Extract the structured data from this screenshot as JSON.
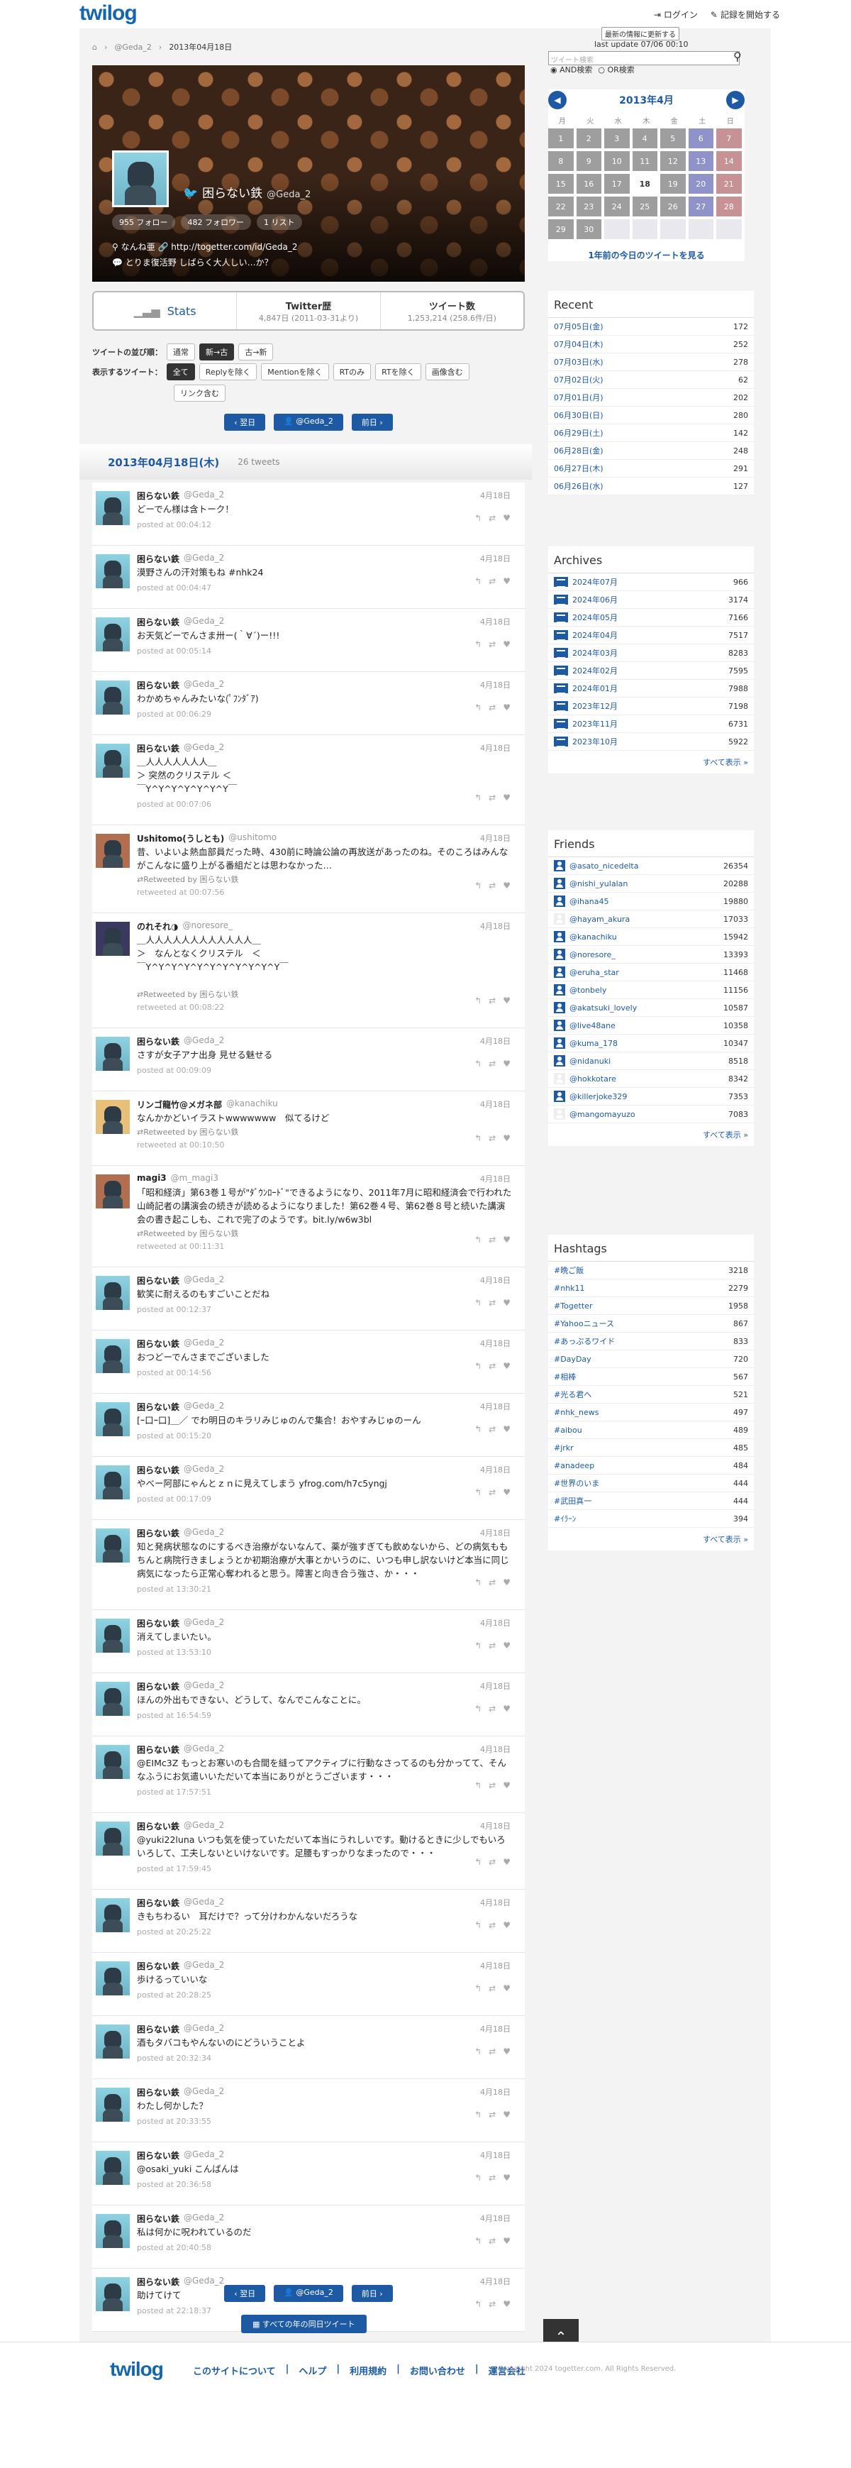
{
  "header": {
    "logo": "twilog",
    "login": "ログイン",
    "start": "記録を開始する"
  },
  "breadcrumb": {
    "user": "@Geda_2",
    "current": "2013年04月18日"
  },
  "profile": {
    "name": "困らない鉄",
    "screen_name": "@Geda_2",
    "followers": "955 フォロー",
    "following": "482 フォロワー",
    "lists": "1 リスト",
    "location": "なんね亜",
    "url": "http://togetter.com/id/Geda_2",
    "bio": "とりま復活野 しばらく大人しい…か？"
  },
  "stats": {
    "label": "Stats",
    "twitter_title": "Twitter歴",
    "twitter_days": "4,847日",
    "twitter_since": "(2011-03-31より)",
    "tweets_title": "ツイート数",
    "tweets_count": "1,253,214",
    "tweets_per": "(258.6件/日)"
  },
  "sort": {
    "label": "ツイートの並び順：",
    "opt1": "通常",
    "opt2": "新→古",
    "opt3": "古→新"
  },
  "filter": {
    "label": "表示するツイート：",
    "opts": [
      "全て",
      "Replyを除く",
      "Mentionを除く",
      "RTのみ",
      "RTを除く",
      "画像含む",
      "リンク含む"
    ]
  },
  "nav": {
    "prev": "翌日",
    "user": "@Geda_2",
    "next": "前日"
  },
  "day": {
    "date": "2013年04月18日(木)",
    "count": "26 tweets"
  },
  "tweets": [
    {
      "name": "困らない鉄",
      "sn": "@Geda_2",
      "date": "4月18日",
      "text": "どーでん様は含トーク！",
      "posted": "posted at 00:04:12",
      "rt": ""
    },
    {
      "name": "困らない鉄",
      "sn": "@Geda_2",
      "date": "4月18日",
      "text": "漠野さんの汗対策もね #nhk24",
      "posted": "posted at 00:04:47",
      "rt": ""
    },
    {
      "name": "困らない鉄",
      "sn": "@Geda_2",
      "date": "4月18日",
      "text": "お天気どーでんさま卅ー(｀∀´)ー!!!",
      "posted": "posted at 00:05:14",
      "rt": ""
    },
    {
      "name": "困らない鉄",
      "sn": "@Geda_2",
      "date": "4月18日",
      "text": "わかめちゃんみたいな(ﾟﾌﾝﾀﾞｱ)",
      "posted": "posted at 00:06:29",
      "rt": ""
    },
    {
      "name": "困らない鉄",
      "sn": "@Geda_2",
      "date": "4月18日",
      "text": "＿人人人人人人人＿\n＞ 突然のクリステル ＜\n￣Y^Y^Y^Y^Y^Y^Y￣",
      "posted": "posted at 00:07:06",
      "rt": ""
    },
    {
      "name": "Ushitomo(うしとも)",
      "sn": "@ushitomo",
      "date": "4月18日",
      "text": "昔、いよいよ熱血部員だった時、430前に時論公論の再放送があったのね。そのころはみんながこんなに盛り上がる番組だとは思わなかった…",
      "posted": "retweeted at 00:07:56",
      "rt": "Retweeted by 困らない鉄"
    },
    {
      "name": "のれそれ◑",
      "sn": "@noresore_",
      "date": "4月18日",
      "text": "＿人人人人人人人人人人人人＿\n＞　なんとなくクリステル　＜\n￣Y^Y^Y^Y^Y^Y^Y^Y^Y^Y^Y￣",
      "posted": "retweeted at 00:08:22",
      "rt": "Retweeted by 困らない鉄"
    },
    {
      "name": "困らない鉄",
      "sn": "@Geda_2",
      "date": "4月18日",
      "text": "さすが女子アナ出身 見せる魅せる",
      "posted": "posted at 00:09:09",
      "rt": ""
    },
    {
      "name": "リンゴ龍竹@メガネ部",
      "sn": "@kanachiku",
      "date": "4月18日",
      "text": "なんかかどいイラストwwwwwww　似てるけど",
      "posted": "retweeted at 00:10:50",
      "rt": "Retweeted by 困らない鉄"
    },
    {
      "name": "magi3",
      "sn": "@m_magi3",
      "date": "4月18日",
      "text": "「昭和経済」第63巻１号が\"ﾀﾞｳﾝﾛｰﾄﾞ\"できるようになり、2011年7月に昭和経済会で行われた山崎記者の講演会の続きが読めるようになりました！第62巻４号、第62巻８号と続いた講演会の書き起こしも、これで完了のようです。bit.ly/w6w3bl",
      "posted": "retweeted at 00:11:31",
      "rt": "Retweeted by 困らない鉄"
    },
    {
      "name": "困らない鉄",
      "sn": "@Geda_2",
      "date": "4月18日",
      "text": "歓笑に耐えるのもすごいことだね",
      "posted": "posted at 00:12:37",
      "rt": ""
    },
    {
      "name": "困らない鉄",
      "sn": "@Geda_2",
      "date": "4月18日",
      "text": "おつどーでんさまでございました",
      "posted": "posted at 00:14:56",
      "rt": ""
    },
    {
      "name": "困らない鉄",
      "sn": "@Geda_2",
      "date": "4月18日",
      "text": "[ｰ口ｰ口]＿／ でわ明日のキラリみじゅのんで集合！おやすみじゅのーん",
      "posted": "posted at 00:15:20",
      "rt": ""
    },
    {
      "name": "困らない鉄",
      "sn": "@Geda_2",
      "date": "4月18日",
      "text": "やべー阿部にゃんとｚｎに見えてしまう yfrog.com/h7c5yngj",
      "posted": "posted at 00:17:09",
      "rt": ""
    },
    {
      "name": "困らない鉄",
      "sn": "@Geda_2",
      "date": "4月18日",
      "text": "知と発病状態なのにするべき治療がないなんて、薬が強すぎても飲めないから、どの病気ももちんと病院行きましょうとか初期治療が大事とかいうのに、いつも申し訳ないけど本当に同じ病気になったら正常心奪われると思う。障害と向き合う強さ、か・・・",
      "posted": "posted at 13:30:21",
      "rt": ""
    },
    {
      "name": "困らない鉄",
      "sn": "@Geda_2",
      "date": "4月18日",
      "text": "消えてしまいたい。",
      "posted": "posted at 13:53:10",
      "rt": ""
    },
    {
      "name": "困らない鉄",
      "sn": "@Geda_2",
      "date": "4月18日",
      "text": "ほんの外出もできない、どうして、なんでこんなことに。",
      "posted": "posted at 16:54:59",
      "rt": ""
    },
    {
      "name": "困らない鉄",
      "sn": "@Geda_2",
      "date": "4月18日",
      "text": "@EIMc3Z もっとお寒いのも合間を縫ってアクティブに行動なさってるのも分かってて、そんなふうにお気遣いいただいて本当にありがとうございます・・・",
      "posted": "posted at 17:57:51",
      "rt": ""
    },
    {
      "name": "困らない鉄",
      "sn": "@Geda_2",
      "date": "4月18日",
      "text": "@yuki22luna いつも気を使っていただいて本当にうれしいです。動けるときに少しでもいろいろして、工夫しないといけないです。足腰もすっかりなまったので・・・",
      "posted": "posted at 17:59:45",
      "rt": ""
    },
    {
      "name": "困らない鉄",
      "sn": "@Geda_2",
      "date": "4月18日",
      "text": "きもちわるい　耳だけで？って分けわかんないだろうな",
      "posted": "posted at 20:25:22",
      "rt": ""
    },
    {
      "name": "困らない鉄",
      "sn": "@Geda_2",
      "date": "4月18日",
      "text": "歩けるっていいな",
      "posted": "posted at 20:28:25",
      "rt": ""
    },
    {
      "name": "困らない鉄",
      "sn": "@Geda_2",
      "date": "4月18日",
      "text": "酒もタバコもやんないのにどういうことよ",
      "posted": "posted at 20:32:34",
      "rt": ""
    },
    {
      "name": "困らない鉄",
      "sn": "@Geda_2",
      "date": "4月18日",
      "text": "わたし何かした？",
      "posted": "posted at 20:33:55",
      "rt": ""
    },
    {
      "name": "困らない鉄",
      "sn": "@Geda_2",
      "date": "4月18日",
      "text": "@osaki_yuki こんばんは",
      "posted": "posted at 20:36:58",
      "rt": ""
    },
    {
      "name": "困らない鉄",
      "sn": "@Geda_2",
      "date": "4月18日",
      "text": "私は何かに呪われているのだ",
      "posted": "posted at 20:40:58",
      "rt": ""
    },
    {
      "name": "困らない鉄",
      "sn": "@Geda_2",
      "date": "4月18日",
      "text": "助けてけて",
      "posted": "posted at 22:18:37",
      "rt": ""
    }
  ],
  "all_years": "すべての年の同日ツイート",
  "footer": {
    "logo": "twilog",
    "links": [
      "このサイトについて",
      "ヘルプ",
      "利用規約",
      "お問い合わせ",
      "運営会社"
    ],
    "copy": "Copyright 2024 togetter.com. All Rights Reserved."
  },
  "sidebar": {
    "update_btn": "最新の情報に更新する",
    "last_update": "last update 07/06 00:10",
    "search_placeholder": "ツイート検索",
    "and": "AND検索",
    "or": "OR検索",
    "cal_title": "2013年4月",
    "weekdays": [
      "月",
      "火",
      "水",
      "木",
      "金",
      "土",
      "日"
    ],
    "cal_link": "1年前の今日のツイートを見る",
    "recent_title": "Recent",
    "recent": [
      [
        "07月05日(金)",
        "172"
      ],
      [
        "07月04日(木)",
        "252"
      ],
      [
        "07月03日(水)",
        "278"
      ],
      [
        "07月02日(火)",
        "62"
      ],
      [
        "07月01日(月)",
        "202"
      ],
      [
        "06月30日(日)",
        "280"
      ],
      [
        "06月29日(土)",
        "142"
      ],
      [
        "06月28日(金)",
        "248"
      ],
      [
        "06月27日(木)",
        "291"
      ],
      [
        "06月26日(水)",
        "127"
      ]
    ],
    "archives_title": "Archives",
    "archives": [
      [
        "2024年07月",
        "966"
      ],
      [
        "2024年06月",
        "3174"
      ],
      [
        "2024年05月",
        "7166"
      ],
      [
        "2024年04月",
        "7517"
      ],
      [
        "2024年03月",
        "8283"
      ],
      [
        "2024年02月",
        "7595"
      ],
      [
        "2024年01月",
        "7988"
      ],
      [
        "2023年12月",
        "7198"
      ],
      [
        "2023年11月",
        "6731"
      ],
      [
        "2023年10月",
        "5922"
      ]
    ],
    "more": "すべて表示 »",
    "friends_title": "Friends",
    "friends": [
      [
        "@asato_nicedelta",
        "26354"
      ],
      [
        "@nishi_yulalan",
        "20288"
      ],
      [
        "@ihana45",
        "19880"
      ],
      [
        "@hayam_akura",
        "17033"
      ],
      [
        "@kanachiku",
        "15942"
      ],
      [
        "@noresore_",
        "13393"
      ],
      [
        "@eruha_star",
        "11468"
      ],
      [
        "@tonbely",
        "11156"
      ],
      [
        "@akatsuki_lovely",
        "10587"
      ],
      [
        "@live48ane",
        "10358"
      ],
      [
        "@kuma_178",
        "10347"
      ],
      [
        "@nidanuki",
        "8518"
      ],
      [
        "@hokkotare",
        "8342"
      ],
      [
        "@killerjoke329",
        "7353"
      ],
      [
        "@mangomayuzo",
        "7083"
      ]
    ],
    "hashtags_title": "Hashtags",
    "hashtags": [
      [
        "#晩ご飯",
        "3218"
      ],
      [
        "#nhk11",
        "2279"
      ],
      [
        "#Togetter",
        "1958"
      ],
      [
        "#Yahooニュース",
        "867"
      ],
      [
        "#あっぷるワイド",
        "833"
      ],
      [
        "#DayDay",
        "720"
      ],
      [
        "#相棒",
        "567"
      ],
      [
        "#光る君へ",
        "521"
      ],
      [
        "#nhk_news",
        "497"
      ],
      [
        "#aibou",
        "489"
      ],
      [
        "#jrkr",
        "485"
      ],
      [
        "#anadeep",
        "484"
      ],
      [
        "#世界のいま",
        "444"
      ],
      [
        "#武田真一",
        "444"
      ],
      [
        "#ｲﾗｰﾝ",
        "394"
      ]
    ]
  }
}
